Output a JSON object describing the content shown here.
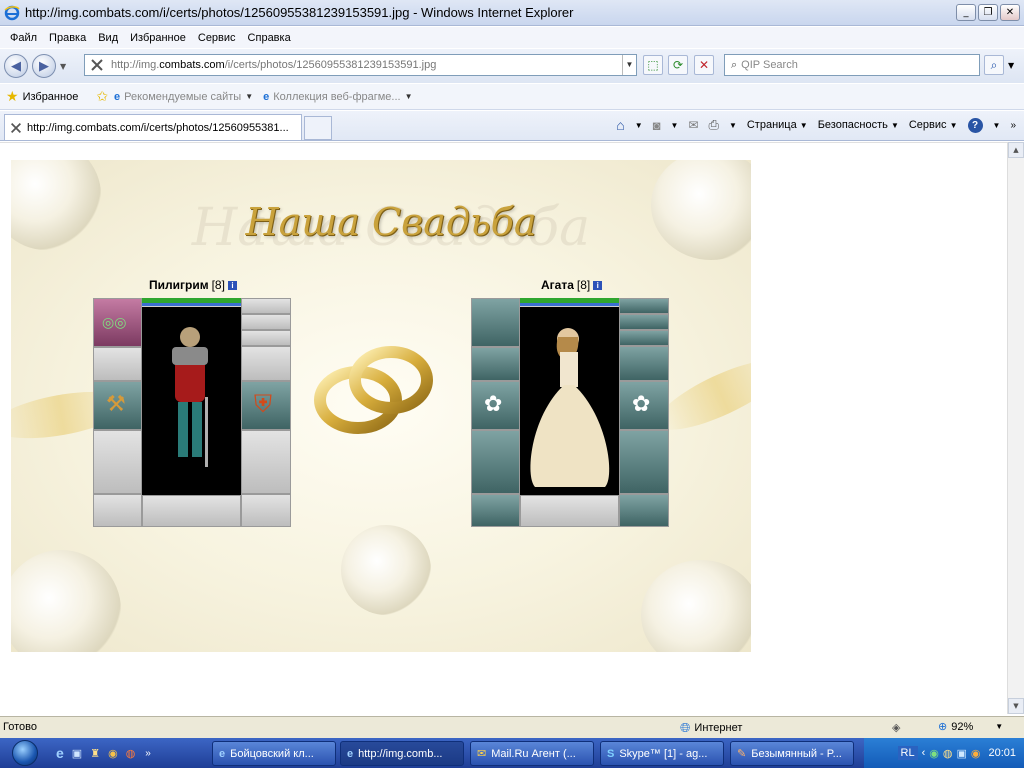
{
  "window": {
    "title": "http://img.combats.com/i/certs/photos/12560955381239153591.jpg - Windows Internet Explorer"
  },
  "menu": [
    "Файл",
    "Правка",
    "Вид",
    "Избранное",
    "Сервис",
    "Справка"
  ],
  "address": {
    "prefix": "http://img.",
    "domain": "combats.com",
    "rest": "/i/certs/photos/12560955381239153591.jpg"
  },
  "search": {
    "placeholder": "QIP Search"
  },
  "favorites": {
    "label": "Избранное",
    "items": [
      "Рекомендуемые сайты",
      "Коллекция веб-фрагме..."
    ]
  },
  "tab": {
    "label": "http://img.combats.com/i/certs/photos/12560955381..."
  },
  "command_bar": [
    "Страница",
    "Безопасность",
    "Сервис"
  ],
  "cert": {
    "title": "Наша Свадьба",
    "left_player": {
      "name": "Пилигрим",
      "level": "[8]"
    },
    "right_player": {
      "name": "Агата",
      "level": "[8]"
    }
  },
  "status": {
    "text": "Готово",
    "zone": "Интернет",
    "zoom": "92%"
  },
  "taskbar": {
    "items": [
      "Бойцовский кл...",
      "http://img.comb...",
      "Mail.Ru Агент (...",
      "Skype™ [1] - ag...",
      "Безымянный - P..."
    ],
    "clock": "20:01",
    "lang": "RL"
  },
  "colors": {
    "hp": "#2fa62f",
    "mp": "#3b6fd0",
    "title_gold": "#c9a23c"
  }
}
